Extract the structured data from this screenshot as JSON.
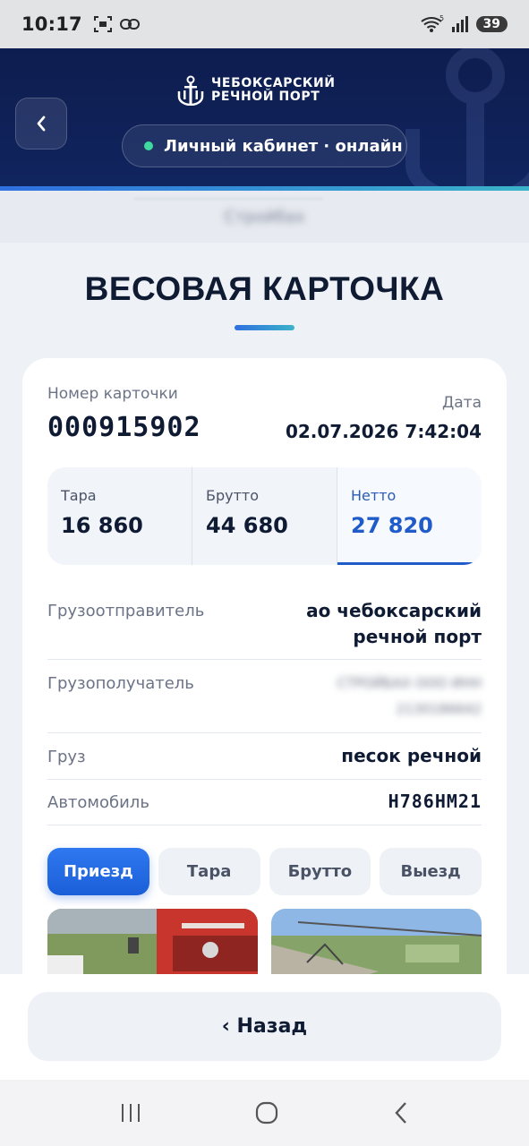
{
  "status_bar": {
    "time": "10:17",
    "battery": "39"
  },
  "header": {
    "logo_line1": "ЧЕБОКСАРСКИЙ",
    "logo_line2": "РЕЧНОЙ ПОРТ",
    "status_text": "Личный кабинет ·  онлайн",
    "status_color": "#3fd9a0"
  },
  "subbar": {
    "text": "Стройбах"
  },
  "page": {
    "title": "ВЕСОВАЯ КАРТОЧКА"
  },
  "card": {
    "number_label": "Номер карточки",
    "number": "000915902",
    "date_label": "Дата",
    "date": "02.07.2026 7:42:04",
    "weights": [
      {
        "label": "Тара",
        "value": "16 860"
      },
      {
        "label": "Брутто",
        "value": "44 680"
      },
      {
        "label": "Нетто",
        "value": "27 820"
      }
    ],
    "shipper_label": "Грузоотправитель",
    "shipper": "ао чебоксарский речной порт",
    "receiver_label": "Грузополучатель",
    "receiver": "СТРОЙБАХ ООО ИНН 2130186642",
    "cargo_label": "Груз",
    "cargo": "песок речной",
    "vehicle_label": "Автомобиль",
    "vehicle": "Н786НМ21",
    "tabs": [
      "Приезд",
      "Тара",
      "Брутто",
      "Выезд"
    ],
    "active_tab": "Приезд"
  },
  "footer": {
    "back_label": "‹ Назад"
  }
}
